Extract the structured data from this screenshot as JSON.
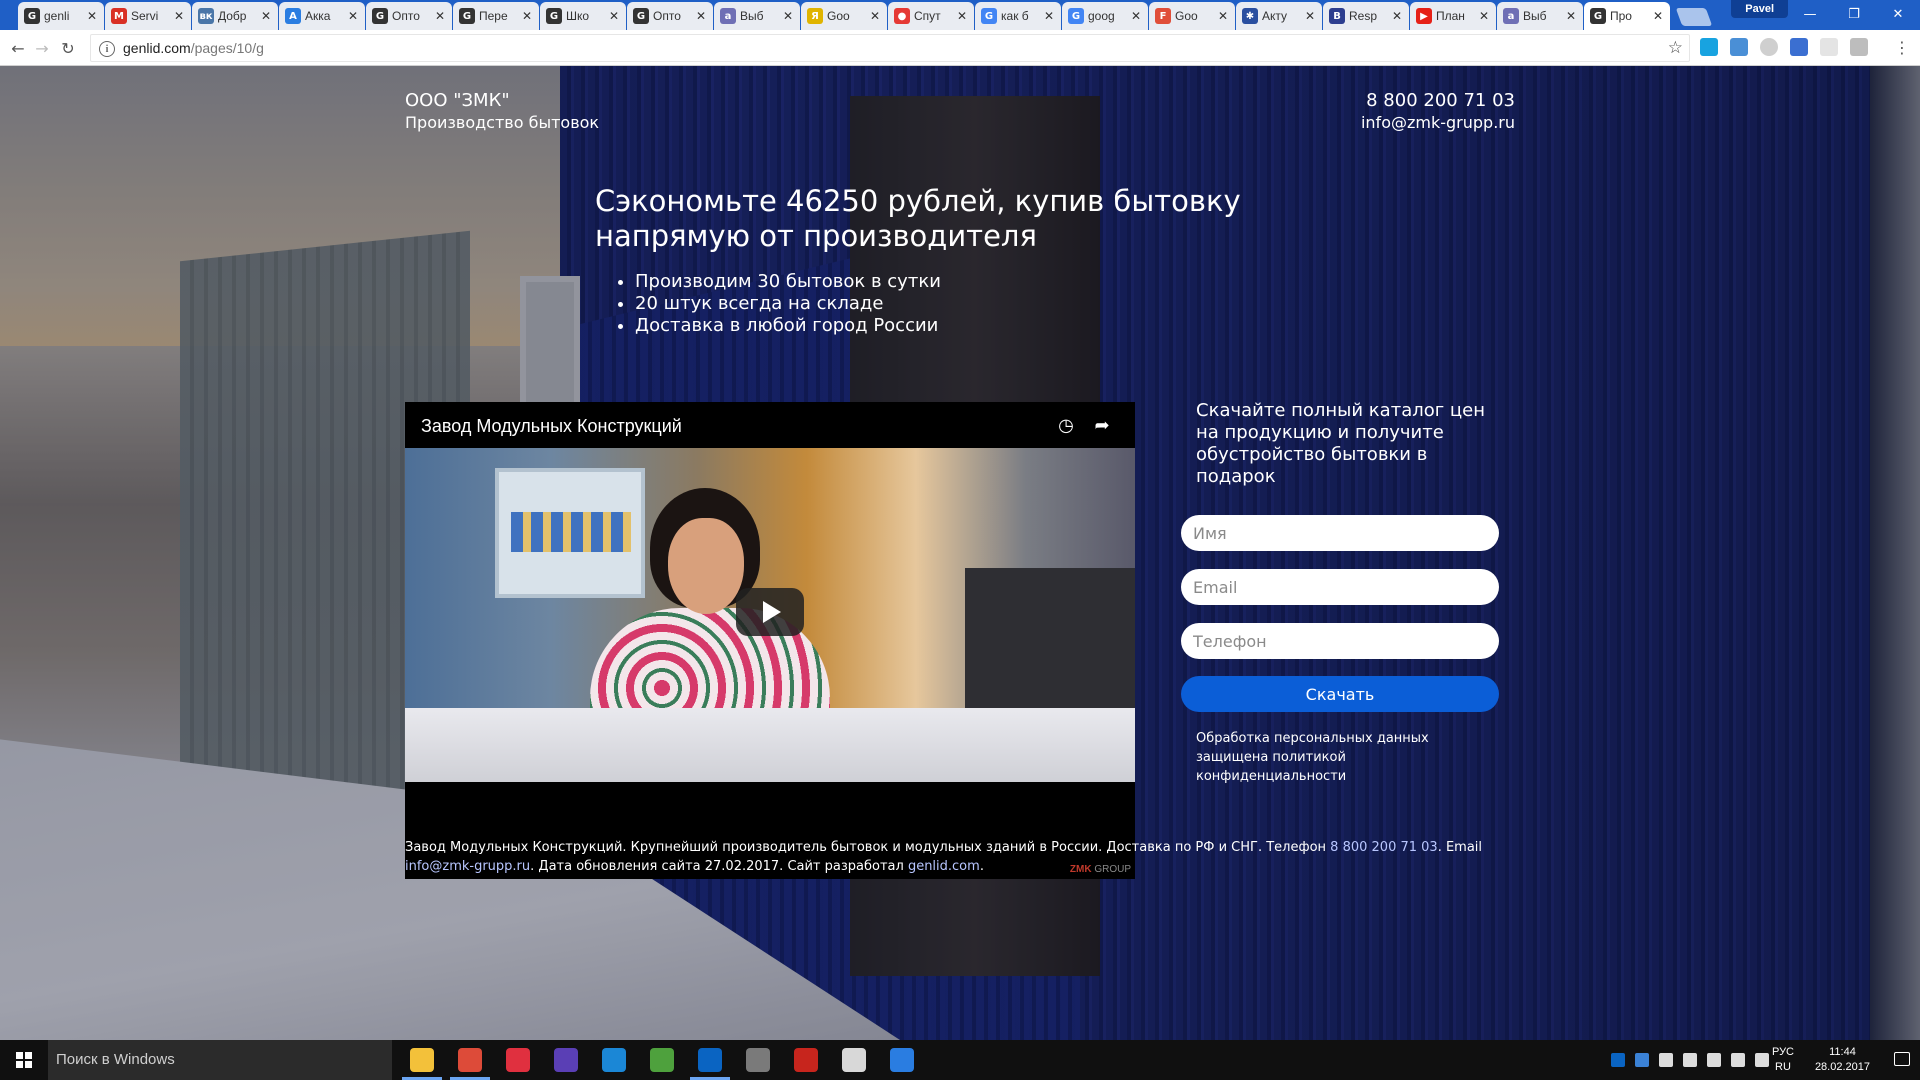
{
  "browser": {
    "tabs": [
      {
        "label": "genli",
        "icon": "genlid-favicon",
        "color": "#333333",
        "letter": "G"
      },
      {
        "label": "Servi",
        "icon": "gmail-favicon",
        "color": "#d93025",
        "letter": "M"
      },
      {
        "label": "Добр",
        "icon": "vk-favicon",
        "color": "#4a76a8",
        "letter": "вк"
      },
      {
        "label": "Акка",
        "icon": "adwords-favicon",
        "color": "#2a7de1",
        "letter": "A"
      },
      {
        "label": "Опто",
        "icon": "genlid-favicon",
        "color": "#333333",
        "letter": "G"
      },
      {
        "label": "Пере",
        "icon": "genlid-favicon",
        "color": "#333333",
        "letter": "G"
      },
      {
        "label": "Шко",
        "icon": "genlid-favicon",
        "color": "#333333",
        "letter": "G"
      },
      {
        "label": "Опто",
        "icon": "genlid-favicon",
        "color": "#333333",
        "letter": "G"
      },
      {
        "label": "Выб",
        "icon": "avito-favicon",
        "color": "#6f6fb5",
        "letter": "a"
      },
      {
        "label": "Goo",
        "icon": "yandex-favicon",
        "color": "#e0b400",
        "letter": "Я"
      },
      {
        "label": "Спут",
        "icon": "maps-pin-favicon",
        "color": "#e53935",
        "letter": "●"
      },
      {
        "label": "как б",
        "icon": "google-favicon",
        "color": "#4285f4",
        "letter": "G"
      },
      {
        "label": "goog",
        "icon": "google-favicon",
        "color": "#4285f4",
        "letter": "G"
      },
      {
        "label": "Goo",
        "icon": "f-favicon",
        "color": "#e04e39",
        "letter": "F"
      },
      {
        "label": "Акту",
        "icon": "wheel-favicon",
        "color": "#2a4fa0",
        "letter": "✱"
      },
      {
        "label": "Resp",
        "icon": "b-favicon",
        "color": "#2d3e8f",
        "letter": "B"
      },
      {
        "label": "План",
        "icon": "youtube-favicon",
        "color": "#e62117",
        "letter": "▶"
      },
      {
        "label": "Выб",
        "icon": "avito-favicon",
        "color": "#6f6fb5",
        "letter": "a"
      },
      {
        "label": "Про",
        "icon": "genlid-favicon",
        "color": "#333333",
        "letter": "G",
        "active": true
      }
    ],
    "profile_name": "Pavel",
    "url_host": "genlid.com",
    "url_path": "/pages/10/g"
  },
  "header": {
    "brand_name": "ООО \"ЗМК\"",
    "brand_sub": "Производство бытовок",
    "phone": "8 800 200 71 03",
    "email": "info@zmk-grupp.ru"
  },
  "hero": {
    "headline_line1": "Сэкономьте 46250 рублей, купив бытовку",
    "headline_line2": "напрямую от производителя",
    "bullets": [
      "Производим 30 бытовок в сутки",
      "20 штук всегда на складе",
      "Доставка в любой город России"
    ]
  },
  "video": {
    "title": "Завод Модульных Конструкций",
    "watermark_brand": "ZMK",
    "watermark_rest": " GROUP"
  },
  "form": {
    "title": "Скачайте полный каталог цен на продукцию и получите обустройство бытовки в подарок",
    "name_placeholder": "Имя",
    "email_placeholder": "Email",
    "phone_placeholder": "Телефон",
    "submit_label": "Скачать",
    "privacy_text": "Обработка персональных данных защищена политикой конфиденциальности"
  },
  "footer": {
    "text_1": "Завод Модульных Конструкций. Крупнейший производитель бытовок и модульных зданий в России. Доставка по РФ и СНГ. Телефон ",
    "phone_link": "8 800 200 71 03",
    "text_2": ". Email ",
    "email_link": "info@zmk-grupp.ru",
    "text_3": ". Дата обновления сайта 27.02.2017. Сайт разработал ",
    "dev_link": "genlid.com",
    "text_4": "."
  },
  "taskbar": {
    "search_placeholder": "Поиск в Windows",
    "apps": [
      {
        "name": "file-explorer-icon",
        "color": "#f3c13a",
        "running": true
      },
      {
        "name": "chrome-icon",
        "color": "#dd4b39",
        "running": true
      },
      {
        "name": "opera-icon",
        "color": "#e0303f",
        "running": false
      },
      {
        "name": "app-purple-icon",
        "color": "#5a3fb5",
        "running": false
      },
      {
        "name": "edge-icon",
        "color": "#1b87d6",
        "running": false
      },
      {
        "name": "xbox-icon",
        "color": "#4ea13d",
        "running": false
      },
      {
        "name": "outlook-icon",
        "color": "#0a64c2",
        "running": true
      },
      {
        "name": "network-tool-icon",
        "color": "#7a7a7a",
        "running": false
      },
      {
        "name": "filezilla-icon",
        "color": "#c7251d",
        "running": false
      },
      {
        "name": "bow-tie-icon",
        "color": "#d8d8d8",
        "running": false
      },
      {
        "name": "adwords-editor-icon",
        "color": "#2a7de1",
        "running": false
      }
    ],
    "lang_line1": "РУС",
    "lang_line2": "RU",
    "time": "11:44",
    "date": "28.02.2017"
  }
}
